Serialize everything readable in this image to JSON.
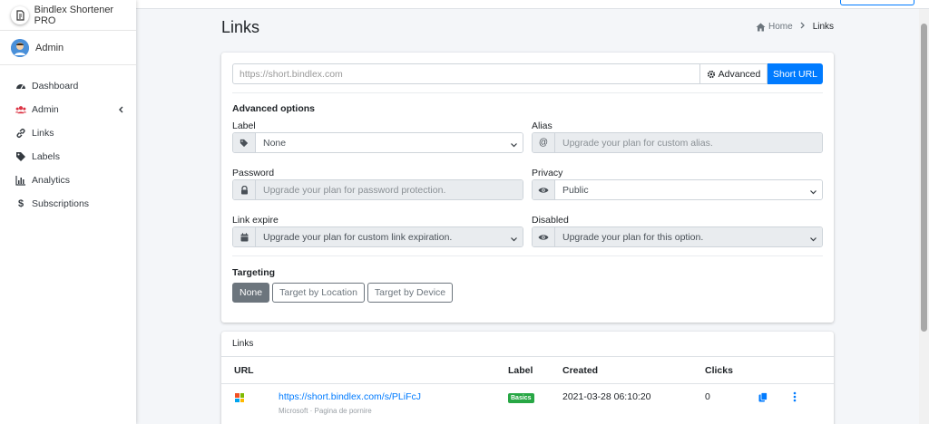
{
  "brand": {
    "name": "Bindlex Shortener PRO"
  },
  "user": {
    "name": "Admin"
  },
  "sidebar": {
    "items": [
      {
        "label": "Dashboard",
        "icon": "dashboard-icon"
      },
      {
        "label": "Admin",
        "icon": "users-icon"
      },
      {
        "label": "Links",
        "icon": "link-icon"
      },
      {
        "label": "Labels",
        "icon": "tag-icon"
      },
      {
        "label": "Analytics",
        "icon": "chart-icon"
      },
      {
        "label": "Subscriptions",
        "icon": "dollar-icon"
      }
    ]
  },
  "header": {
    "title": "Links",
    "breadcrumb": {
      "home": "Home",
      "current": "Links"
    }
  },
  "shorten": {
    "placeholder": "https://short.bindlex.com",
    "advanced_label": "Advanced",
    "submit_label": "Short URL"
  },
  "advanced": {
    "title": "Advanced options",
    "label": {
      "label": "Label",
      "value": "None"
    },
    "alias": {
      "label": "Alias",
      "placeholder": "Upgrade your plan for custom alias."
    },
    "password": {
      "label": "Password",
      "placeholder": "Upgrade your plan for password protection."
    },
    "privacy": {
      "label": "Privacy",
      "value": "Public"
    },
    "expire": {
      "label": "Link expire",
      "value": "Upgrade your plan for custom link expiration."
    },
    "disabled": {
      "label": "Disabled",
      "value": "Upgrade your plan for this option."
    }
  },
  "targeting": {
    "title": "Targeting",
    "options": [
      "None",
      "Target by Location",
      "Target by Device"
    ],
    "selected": "None"
  },
  "links": {
    "title": "Links",
    "columns": {
      "url": "URL",
      "label": "Label",
      "created": "Created",
      "clicks": "Clicks"
    },
    "rows": [
      {
        "url": "https://short.bindlex.com/s/PLiFcJ",
        "subtitle": "Microsoft · Pagina de pornire",
        "label": "Basics",
        "created": "2021-03-28 06:10:20",
        "clicks": "0"
      }
    ]
  },
  "colors": {
    "primary": "#007bff",
    "secondary": "#6c757d",
    "success": "#28a745"
  }
}
